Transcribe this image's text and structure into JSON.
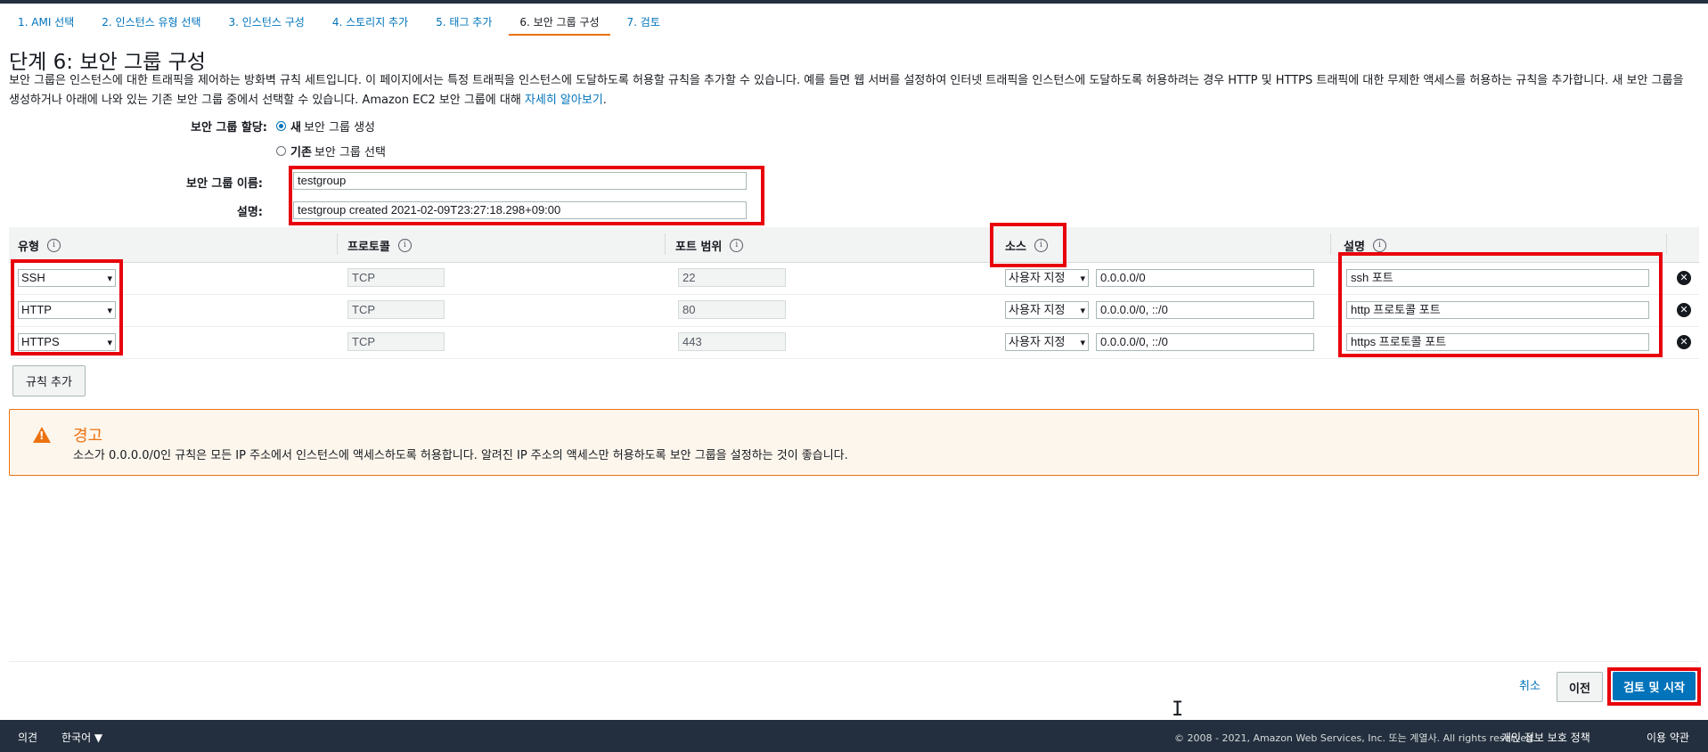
{
  "wizard_tabs": [
    "1. AMI 선택",
    "2. 인스턴스 유형 선택",
    "3. 인스턴스 구성",
    "4. 스토리지 추가",
    "5. 태그 추가",
    "6. 보안 그룹 구성",
    "7. 검토"
  ],
  "active_tab_index": 5,
  "page_title": "단계 6: 보안 그룹 구성",
  "description": {
    "text": "보안 그룹은 인스턴스에 대한 트래픽을 제어하는 방화벽 규칙 세트입니다. 이 페이지에서는 특정 트래픽을 인스턴스에 도달하도록 허용할 규칙을 추가할 수 있습니다. 예를 들면 웹 서버를 설정하여 인터넷 트래픽을 인스턴스에 도달하도록 허용하려는 경우 HTTP 및 HTTPS 트래픽에 대한 무제한 액세스를 허용하는 규칙을 추가합니다. 새 보안 그룹을 생성하거나 아래에 나와 있는 기존 보안 그룹 중에서 선택할 수 있습니다. Amazon EC2 보안 그룹에 대해",
    "link": "자세히 알아보기",
    "suffix": "."
  },
  "assignment": {
    "label": "보안 그룹 할당:",
    "option_new_bold": "새",
    "option_new_rest": "보안 그룹 생성",
    "option_existing_bold": "기존",
    "option_existing_rest": "보안 그룹 선택",
    "selected": "new"
  },
  "group_name": {
    "label": "보안 그룹 이름:",
    "value": "testgroup"
  },
  "group_description": {
    "label": "설명:",
    "value": "testgroup created 2021-02-09T23:27:18.298+09:00"
  },
  "table": {
    "headers": {
      "type": "유형",
      "protocol": "프로토콜",
      "port": "포트 범위",
      "source": "소스",
      "description": "설명"
    },
    "rows": [
      {
        "type": "SSH",
        "protocol": "TCP",
        "port": "22",
        "source_mode": "사용자 지정",
        "source_cidr": "0.0.0.0/0",
        "description": "ssh 포트"
      },
      {
        "type": "HTTP",
        "protocol": "TCP",
        "port": "80",
        "source_mode": "사용자 지정",
        "source_cidr": "0.0.0.0/0, ::/0",
        "description": "http 프로토콜 포트"
      },
      {
        "type": "HTTPS",
        "protocol": "TCP",
        "port": "443",
        "source_mode": "사용자 지정",
        "source_cidr": "0.0.0.0/0, ::/0",
        "description": "https 프로토콜 포트"
      }
    ]
  },
  "add_rule_label": "규칙 추가",
  "warning": {
    "title": "경고",
    "text": "소스가 0.0.0.0/0인 규칙은 모든 IP 주소에서 인스턴스에 액세스하도록 허용합니다. 알려진 IP 주소의 액세스만 허용하도록 보안 그룹을 설정하는 것이 좋습니다."
  },
  "actions": {
    "cancel": "취소",
    "previous": "이전",
    "review_launch": "검토 및 시작"
  },
  "footer": {
    "feedback": "의견",
    "language": "한국어 ▼",
    "copyright": "© 2008 - 2021, Amazon Web Services, Inc. 또는 계열사. All rights reserved.",
    "privacy": "개인 정보 보호 정책",
    "terms": "이용 약관"
  },
  "colors": {
    "accent": "#0073bb",
    "highlight": "#e8000b",
    "warning": "#ec7211",
    "nav": "#232f3e"
  }
}
